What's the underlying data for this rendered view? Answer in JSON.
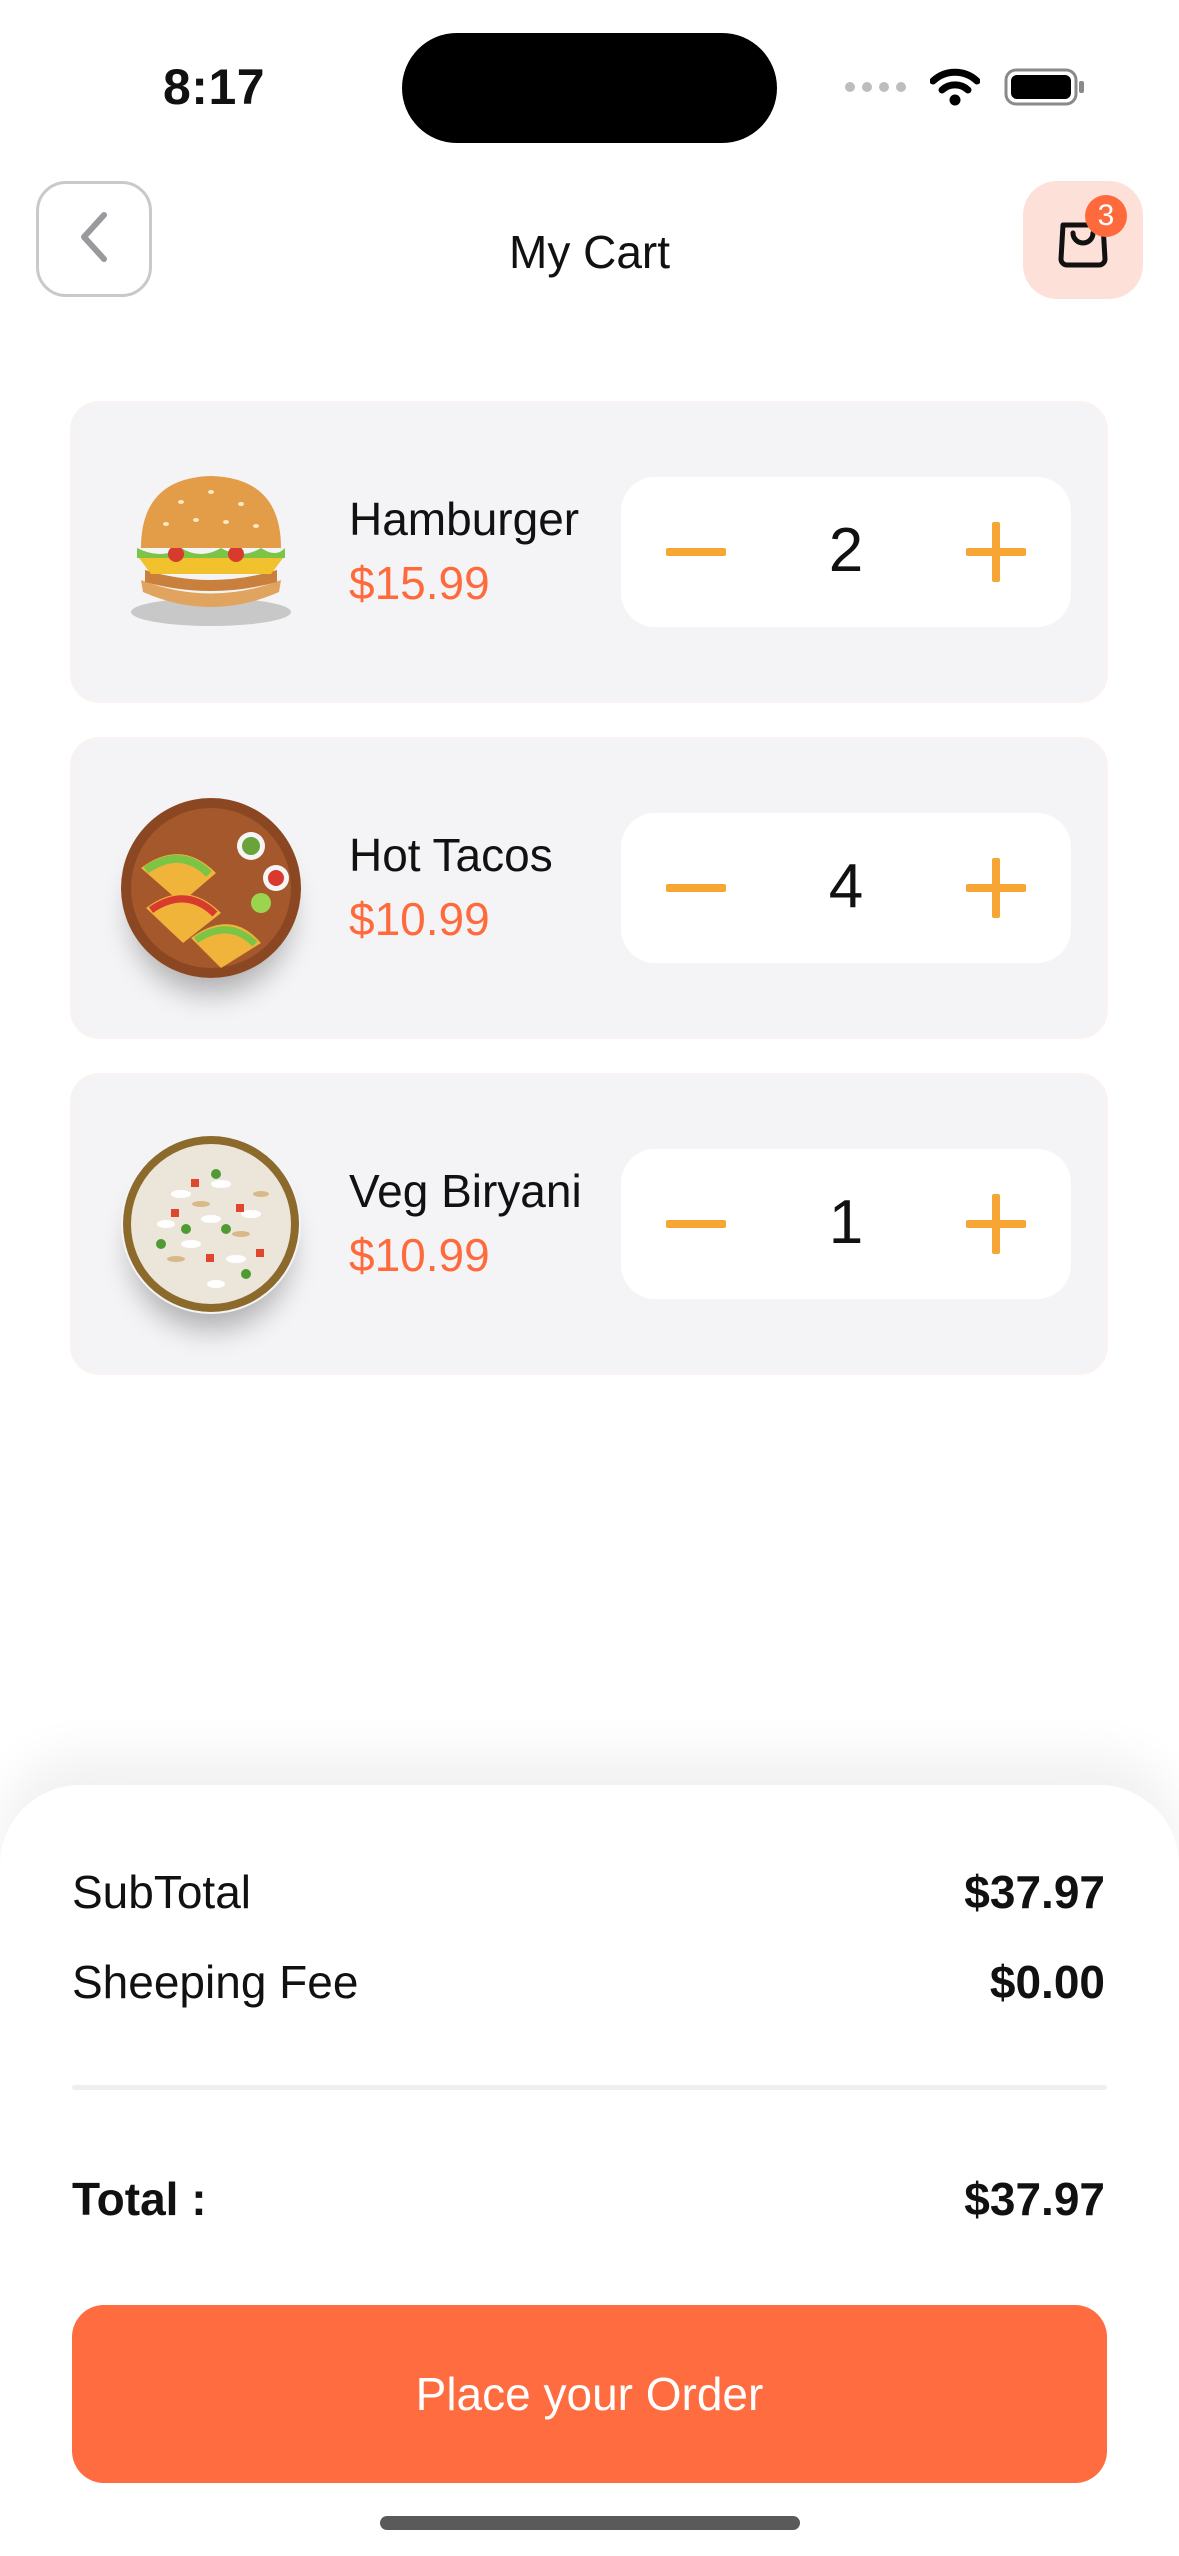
{
  "status_bar": {
    "time": "8:17"
  },
  "header": {
    "title": "My Cart",
    "cart_count": "3"
  },
  "items": [
    {
      "name": "Hamburger",
      "price": "$15.99",
      "quantity": "2"
    },
    {
      "name": "Hot Tacos",
      "price": "$10.99",
      "quantity": "4"
    },
    {
      "name": "Veg Biryani",
      "price": "$10.99",
      "quantity": "1"
    }
  ],
  "summary": {
    "subtotal_label": "SubTotal",
    "subtotal_value": "$37.97",
    "shipping_label": "Sheeping Fee",
    "shipping_value": "$0.00",
    "total_label": "Total :",
    "total_value": "$37.97"
  },
  "order_button": {
    "label": "Place your Order"
  },
  "colors": {
    "accent": "#ff6c40",
    "stepper": "#f7a534",
    "card": "#f4f4f6",
    "cart_bg": "#fde1d9"
  },
  "icons": [
    "chevron-left-icon",
    "shopping-bag-icon",
    "minus-icon",
    "plus-icon",
    "wifi-icon",
    "battery-icon",
    "signal-icon"
  ]
}
